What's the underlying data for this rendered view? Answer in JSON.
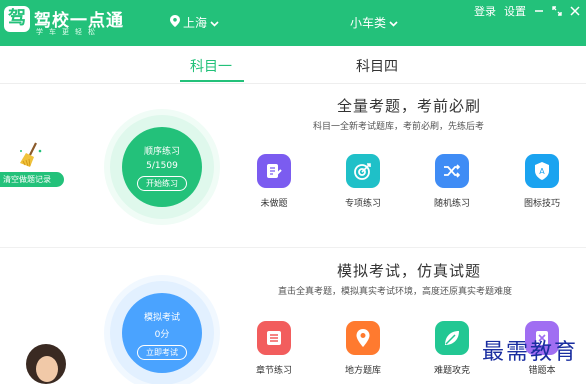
{
  "header": {
    "logo_char": "驾",
    "brand": "驾校一点通",
    "slogan": "学车更轻松",
    "city": "上海",
    "car_type": "小车类",
    "login": "登录",
    "settings": "设置"
  },
  "tabs": [
    {
      "label": "科目一",
      "active": true
    },
    {
      "label": "科目四",
      "active": false
    }
  ],
  "section1": {
    "title": "全量考题，考前必刷",
    "subtitle": "科目一全新考试题库，考前必刷，先练后考",
    "circle_title": "顺序练习",
    "circle_count": "5/1509",
    "circle_button": "开始练习",
    "clear_label": "清空做题记录",
    "features": [
      {
        "label": "未做题",
        "icon": "edit-doc-icon",
        "color": "#7b5cf0"
      },
      {
        "label": "专项练习",
        "icon": "target-icon",
        "color": "#1fc0c8"
      },
      {
        "label": "随机练习",
        "icon": "shuffle-icon",
        "color": "#3f8cf5"
      },
      {
        "label": "图标技巧",
        "icon": "shield-a-icon",
        "color": "#1aa3f0"
      }
    ]
  },
  "section2": {
    "title": "模拟考试，仿真试题",
    "subtitle": "直击全真考题，模拟真实考试环境，高度还原真实考题难度",
    "circle_title": "模拟考试",
    "circle_count": "0分",
    "circle_button": "立即考试",
    "features": [
      {
        "label": "章节练习",
        "icon": "list-icon",
        "color": "#f25d5d"
      },
      {
        "label": "地方题库",
        "icon": "location-pin-icon",
        "color": "#ff7a2f"
      },
      {
        "label": "难题攻克",
        "icon": "leaf-icon",
        "color": "#22c793"
      },
      {
        "label": "错题本",
        "icon": "wrong-book-icon",
        "color": "#a06ef2"
      }
    ]
  },
  "watermark": "最需教育",
  "colors": {
    "brand_green": "#23c17a",
    "blue": "#4aa3ff"
  }
}
